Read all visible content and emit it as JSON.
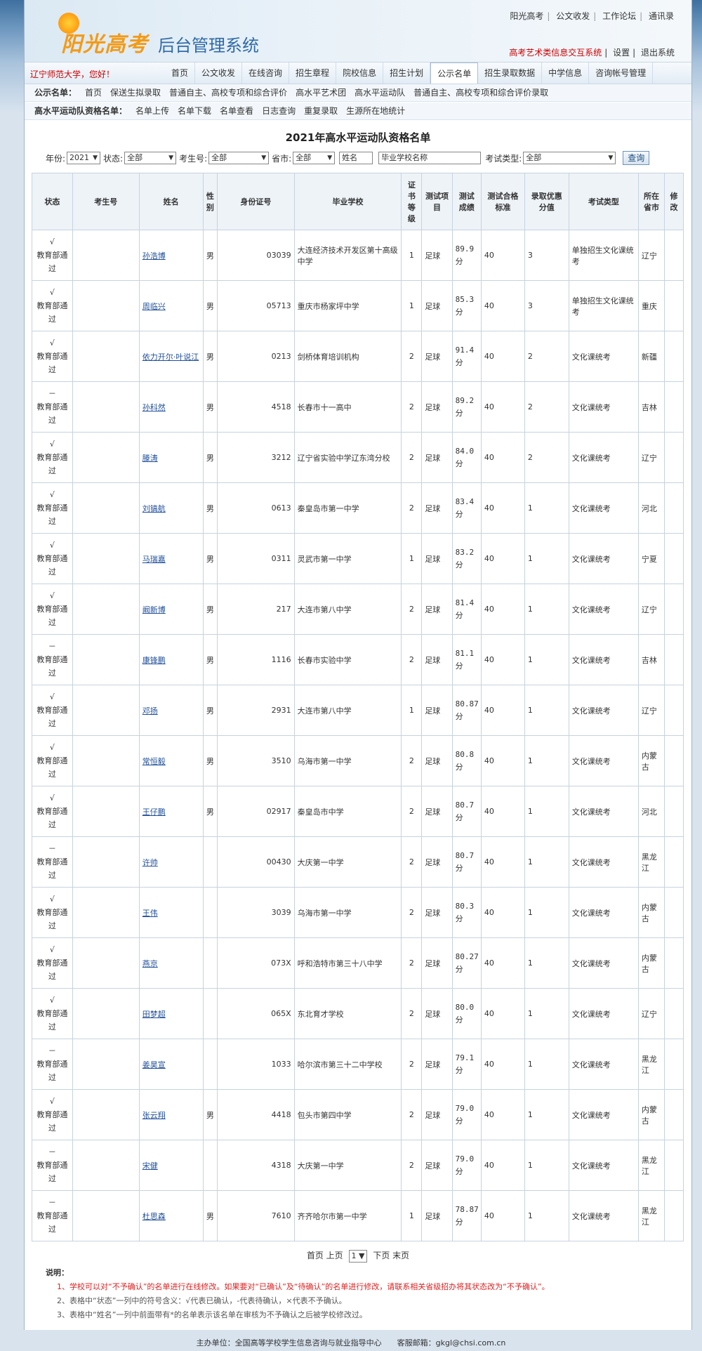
{
  "header": {
    "logo_text": "阳光高考",
    "system_title": "后台管理系统",
    "top_links": [
      "阳光高考",
      "公文收发",
      "工作论坛",
      "通讯录"
    ],
    "sub_links_red": "高考艺术类信息交互系统",
    "sub_links": [
      "设置",
      "退出系统"
    ]
  },
  "nav": {
    "greeting": "辽宁师范大学，您好！",
    "items": [
      "首页",
      "公文收发",
      "在线咨询",
      "招生章程",
      "院校信息",
      "招生计划",
      "公示名单",
      "招生录取数据",
      "中学信息",
      "咨询帐号管理"
    ],
    "active": "公示名单"
  },
  "subnav1": {
    "label": "公示名单：",
    "items": [
      "首页",
      "保送生拟录取",
      "普通自主、高校专项和综合评价",
      "高水平艺术团",
      "高水平运动队",
      "普通自主、高校专项和综合评价录取"
    ]
  },
  "subnav2": {
    "label": "高水平运动队资格名单：",
    "items": [
      "名单上传",
      "名单下载",
      "名单查看",
      "日志查询",
      "重复录取",
      "生源所在地统计"
    ]
  },
  "page_title": "2021年高水平运动队资格名单",
  "filters": {
    "year_label": "年份:",
    "year_value": "2021",
    "status_label": "状态:",
    "status_value": "全部",
    "ksh_label": "考生号:",
    "ksh_value": "全部",
    "province_label": "省市:",
    "province_value": "全部",
    "name_value": "姓名",
    "school_value": "毕业学校名称",
    "exam_type_label": "考试类型:",
    "exam_type_value": "全部",
    "query_button": "查询"
  },
  "table": {
    "headers": [
      "状态",
      "考生号",
      "姓名",
      "性别",
      "身份证号",
      "毕业学校",
      "证书等级",
      "测试项目",
      "测试成绩",
      "测试合格标准",
      "录取优惠分值",
      "考试类型",
      "所在省市",
      "修改"
    ],
    "rows": [
      {
        "mark": "√",
        "status": "教育部通过",
        "ksh": "",
        "name": "孙浩博",
        "gender": "男",
        "id": "03039",
        "school": "大连经济技术开发区第十高级中学",
        "level": "1",
        "item": "足球",
        "score": "89.9分",
        "std": "40",
        "bonus": "3",
        "type": "单独招生文化课统考",
        "prov": "辽宁"
      },
      {
        "mark": "√",
        "status": "教育部通过",
        "ksh": "",
        "name": "周临兴",
        "gender": "男",
        "id": "05713",
        "school": "重庆市杨家坪中学",
        "level": "1",
        "item": "足球",
        "score": "85.3分",
        "std": "40",
        "bonus": "3",
        "type": "单独招生文化课统考",
        "prov": "重庆"
      },
      {
        "mark": "√",
        "status": "教育部通过",
        "ksh": "",
        "name": "依力开尔·叶说江",
        "gender": "男",
        "id": "0213",
        "school": "剑桥体育培训机构",
        "level": "2",
        "item": "足球",
        "score": "91.4分",
        "std": "40",
        "bonus": "2",
        "type": "文化课统考",
        "prov": "新疆"
      },
      {
        "mark": "－",
        "status": "教育部通过",
        "ksh": "",
        "name": "孙科然",
        "gender": "男",
        "id": "4518",
        "school": "长春市十一高中",
        "level": "2",
        "item": "足球",
        "score": "89.2分",
        "std": "40",
        "bonus": "2",
        "type": "文化课统考",
        "prov": "吉林"
      },
      {
        "mark": "√",
        "status": "教育部通过",
        "ksh": "",
        "name": "滕涛",
        "gender": "男",
        "id": "3212",
        "school": "辽宁省实验中学辽东湾分校",
        "level": "2",
        "item": "足球",
        "score": "84.0分",
        "std": "40",
        "bonus": "2",
        "type": "文化课统考",
        "prov": "辽宁"
      },
      {
        "mark": "√",
        "status": "教育部通过",
        "ksh": "",
        "name": "刘镐航",
        "gender": "男",
        "id": "0613",
        "school": "秦皇岛市第一中学",
        "level": "2",
        "item": "足球",
        "score": "83.4分",
        "std": "40",
        "bonus": "1",
        "type": "文化课统考",
        "prov": "河北"
      },
      {
        "mark": "√",
        "status": "教育部通过",
        "ksh": "",
        "name": "马瑞嘉",
        "gender": "男",
        "id": "0311",
        "school": "灵武市第一中学",
        "level": "1",
        "item": "足球",
        "score": "83.2分",
        "std": "40",
        "bonus": "1",
        "type": "文化课统考",
        "prov": "宁夏"
      },
      {
        "mark": "√",
        "status": "教育部通过",
        "ksh": "",
        "name": "阚新博",
        "gender": "男",
        "id": "217",
        "school": "大连市第八中学",
        "level": "2",
        "item": "足球",
        "score": "81.4分",
        "std": "40",
        "bonus": "1",
        "type": "文化课统考",
        "prov": "辽宁"
      },
      {
        "mark": "－",
        "status": "教育部通过",
        "ksh": "",
        "name": "康锋鹏",
        "gender": "男",
        "id": "1116",
        "school": "长春市实验中学",
        "level": "2",
        "item": "足球",
        "score": "81.1分",
        "std": "40",
        "bonus": "1",
        "type": "文化课统考",
        "prov": "吉林"
      },
      {
        "mark": "√",
        "status": "教育部通过",
        "ksh": "",
        "name": "邓扬",
        "gender": "男",
        "id": "2931",
        "school": "大连市第八中学",
        "level": "1",
        "item": "足球",
        "score": "80.87分",
        "std": "40",
        "bonus": "1",
        "type": "文化课统考",
        "prov": "辽宁"
      },
      {
        "mark": "√",
        "status": "教育部通过",
        "ksh": "",
        "name": "常恒毅",
        "gender": "男",
        "id": "3510",
        "school": "乌海市第一中学",
        "level": "2",
        "item": "足球",
        "score": "80.8分",
        "std": "40",
        "bonus": "1",
        "type": "文化课统考",
        "prov": "内蒙古"
      },
      {
        "mark": "√",
        "status": "教育部通过",
        "ksh": "",
        "name": "王仔鹏",
        "gender": "男",
        "id": "02917",
        "school": "秦皇岛市中学",
        "level": "2",
        "item": "足球",
        "score": "80.7分",
        "std": "40",
        "bonus": "1",
        "type": "文化课统考",
        "prov": "河北"
      },
      {
        "mark": "－",
        "status": "教育部通过",
        "ksh": "",
        "name": "许帅",
        "gender": "",
        "id": "00430",
        "school": "大庆第一中学",
        "level": "2",
        "item": "足球",
        "score": "80.7分",
        "std": "40",
        "bonus": "1",
        "type": "文化课统考",
        "prov": "黑龙江"
      },
      {
        "mark": "√",
        "status": "教育部通过",
        "ksh": "",
        "name": "王伟",
        "gender": "",
        "id": "3039",
        "school": "乌海市第一中学",
        "level": "2",
        "item": "足球",
        "score": "80.3分",
        "std": "40",
        "bonus": "1",
        "type": "文化课统考",
        "prov": "内蒙古"
      },
      {
        "mark": "√",
        "status": "教育部通过",
        "ksh": "",
        "name": "燕京",
        "gender": "",
        "id": "073X",
        "school": "呼和浩特市第三十八中学",
        "level": "2",
        "item": "足球",
        "score": "80.27分",
        "std": "40",
        "bonus": "1",
        "type": "文化课统考",
        "prov": "内蒙古"
      },
      {
        "mark": "√",
        "status": "教育部通过",
        "ksh": "",
        "name": "田梦超",
        "gender": "",
        "id": "065X",
        "school": "东北育才学校",
        "level": "2",
        "item": "足球",
        "score": "80.0分",
        "std": "40",
        "bonus": "1",
        "type": "文化课统考",
        "prov": "辽宁"
      },
      {
        "mark": "－",
        "status": "教育部通过",
        "ksh": "",
        "name": "姜昊宣",
        "gender": "",
        "id": "1033",
        "school": "哈尔滨市第三十二中学校",
        "level": "2",
        "item": "足球",
        "score": "79.1分",
        "std": "40",
        "bonus": "1",
        "type": "文化课统考",
        "prov": "黑龙江"
      },
      {
        "mark": "√",
        "status": "教育部通过",
        "ksh": "",
        "name": "张云翔",
        "gender": "男",
        "id": "4418",
        "school": "包头市第四中学",
        "level": "2",
        "item": "足球",
        "score": "79.0分",
        "std": "40",
        "bonus": "1",
        "type": "文化课统考",
        "prov": "内蒙古"
      },
      {
        "mark": "－",
        "status": "教育部通过",
        "ksh": "",
        "name": "宋健",
        "gender": "",
        "id": "4318",
        "school": "大庆第一中学",
        "level": "2",
        "item": "足球",
        "score": "79.0分",
        "std": "40",
        "bonus": "1",
        "type": "文化课统考",
        "prov": "黑龙江"
      },
      {
        "mark": "－",
        "status": "教育部通过",
        "ksh": "",
        "name": "杜思森",
        "gender": "男",
        "id": "7610",
        "school": "齐齐哈尔市第一中学",
        "level": "1",
        "item": "足球",
        "score": "78.87分",
        "std": "40",
        "bonus": "1",
        "type": "文化课统考",
        "prov": "黑龙江"
      }
    ]
  },
  "pager": {
    "first": "首页",
    "prev": "上页",
    "page": "1",
    "next": "下页",
    "last": "末页"
  },
  "notes": {
    "title": "说明：",
    "n1": "1、学校可以对“不予确认”的名单进行在线修改。如果要对“已确认”及“待确认”的名单进行修改，请联系相关省级招办将其状态改为“不予确认”。",
    "n2": "2、表格中“状态”一列中的符号含义：√代表已确认，-代表待确认，×代表不予确认。",
    "n3": "3、表格中“姓名”一列中前面带有*的名单表示该名单在审核为不予确认之后被学校修改过。"
  },
  "footer": "主办单位：全国高等学校学生信息咨询与就业指导中心　　客服邮箱：gkgl@chsi.com.cn"
}
